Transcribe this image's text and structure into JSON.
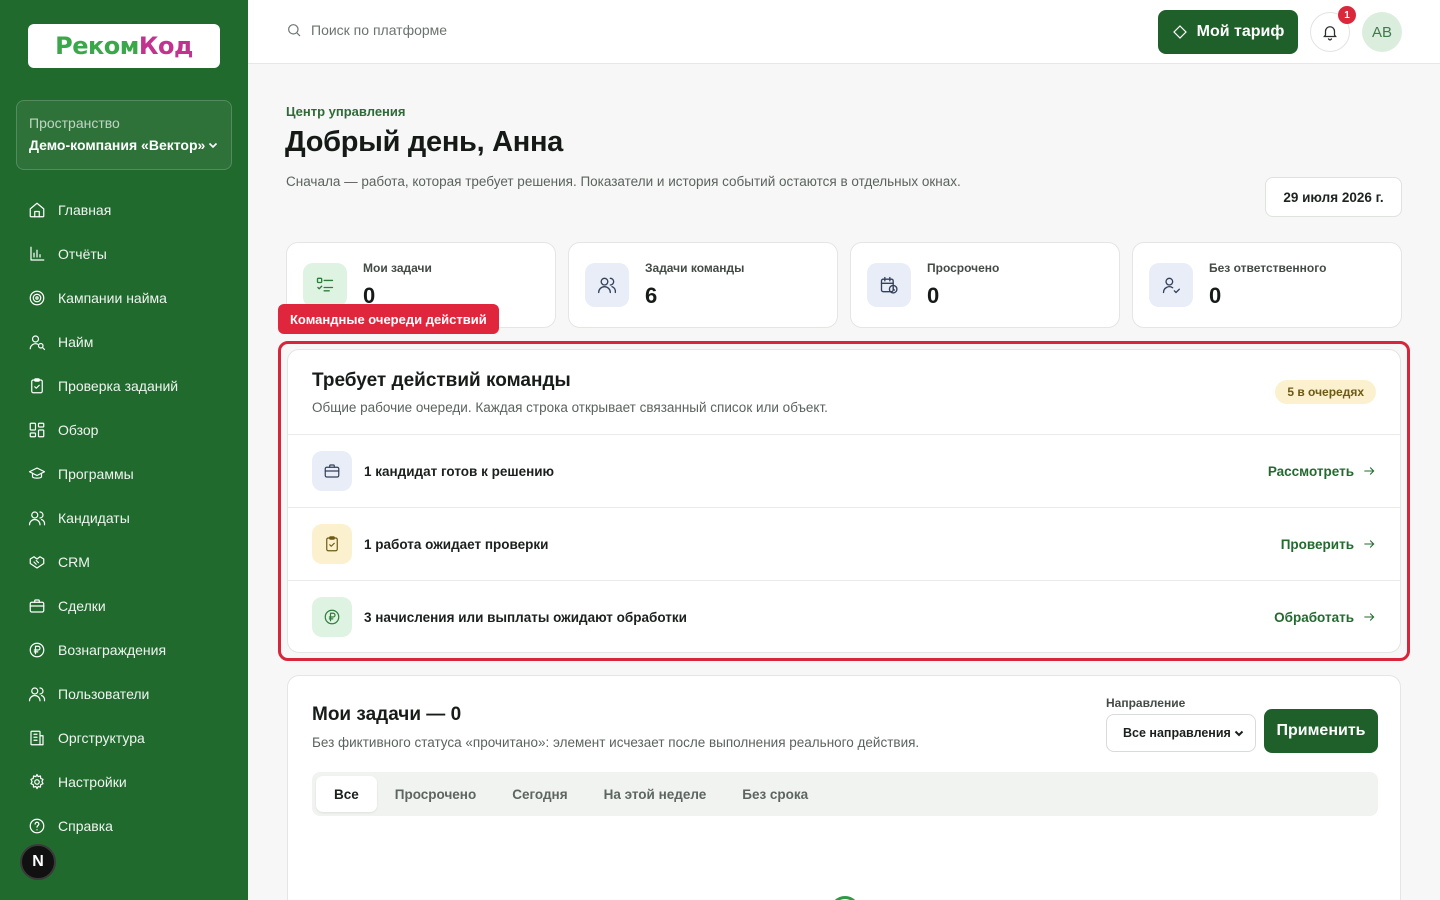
{
  "brand": {
    "logo_text_a": "Реком",
    "logo_text_b": "Код"
  },
  "sidebar": {
    "space_label": "Пространство",
    "space_value": "Демо-компания «Вектор»",
    "items": [
      {
        "label": "Главная",
        "icon": "home-icon"
      },
      {
        "label": "Отчёты",
        "icon": "bar-chart-icon"
      },
      {
        "label": "Кампании найма",
        "icon": "target-icon"
      },
      {
        "label": "Найм",
        "icon": "user-search-icon"
      },
      {
        "label": "Проверка заданий",
        "icon": "clipboard-check-icon"
      },
      {
        "label": "Обзор",
        "icon": "dashboard-icon"
      },
      {
        "label": "Программы",
        "icon": "graduation-cap-icon"
      },
      {
        "label": "Кандидаты",
        "icon": "users-icon"
      },
      {
        "label": "CRM",
        "icon": "handshake-icon"
      },
      {
        "label": "Сделки",
        "icon": "briefcase-icon"
      },
      {
        "label": "Вознаграждения",
        "icon": "ruble-coin-icon"
      },
      {
        "label": "Пользователи",
        "icon": "users-icon"
      },
      {
        "label": "Оргструктура",
        "icon": "building-icon"
      },
      {
        "label": "Настройки",
        "icon": "gear-icon"
      },
      {
        "label": "Справка",
        "icon": "help-circle-icon"
      }
    ],
    "bottom_badge": "N"
  },
  "topbar": {
    "search_placeholder": "Поиск по платформе",
    "plan_label": "Мой тариф",
    "notification_count": "1",
    "avatar_initials": "AB"
  },
  "header": {
    "kicker": "Центр управления",
    "title": "Добрый день, Анна",
    "subtitle": "Сначала — работа, которая требует решения. Показатели и история событий остаются в отдельных окнах.",
    "date": "29 июля 2026 г."
  },
  "stats": [
    {
      "label": "Мои задачи",
      "value": "0",
      "icon": "checklist-icon",
      "tint": "#dff3e3",
      "stroke": "#2f7d3a"
    },
    {
      "label": "Задачи команды",
      "value": "6",
      "icon": "users-icon",
      "tint": "#e8edf7",
      "stroke": "#34405a"
    },
    {
      "label": "Просрочено",
      "value": "0",
      "icon": "calendar-clock-icon",
      "tint": "#e8edf7",
      "stroke": "#34405a"
    },
    {
      "label": "Без ответственного",
      "value": "0",
      "icon": "user-check-icon",
      "tint": "#e8edf7",
      "stroke": "#34405a"
    }
  ],
  "callout": {
    "label": "Командные очереди действий"
  },
  "actions": {
    "title": "Требует действий команды",
    "subtitle": "Общие рабочие очереди. Каждая строка открывает связанный список или объект.",
    "badge": "5 в очередях",
    "rows": [
      {
        "text": "1 кандидат готов к решению",
        "action": "Рассмотреть",
        "icon": "briefcase-icon",
        "tint": "#e8edf7",
        "stroke": "#34405a"
      },
      {
        "text": "1 работа ожидает проверки",
        "action": "Проверить",
        "icon": "clipboard-check-icon",
        "tint": "#fbf1cf",
        "stroke": "#6d5a14"
      },
      {
        "text": "3 начисления или выплаты ожидают обработки",
        "action": "Обработать",
        "icon": "ruble-coin-icon",
        "tint": "#dff3e3",
        "stroke": "#2f7d3a"
      }
    ]
  },
  "tasks": {
    "title": "Мои задачи — 0",
    "subtitle": "Без фиктивного статуса «прочитано»: элемент исчезает после выполнения реального действия.",
    "direction_label": "Направление",
    "direction_value": "Все направления",
    "apply_label": "Применить",
    "tabs": [
      "Все",
      "Просрочено",
      "Сегодня",
      "На этой неделе",
      "Без срока"
    ],
    "active_tab": "Все"
  },
  "colors": {
    "sidebar_bg": "#216a2e",
    "primary": "#1f5f2a",
    "highlight": "#d7253b"
  }
}
